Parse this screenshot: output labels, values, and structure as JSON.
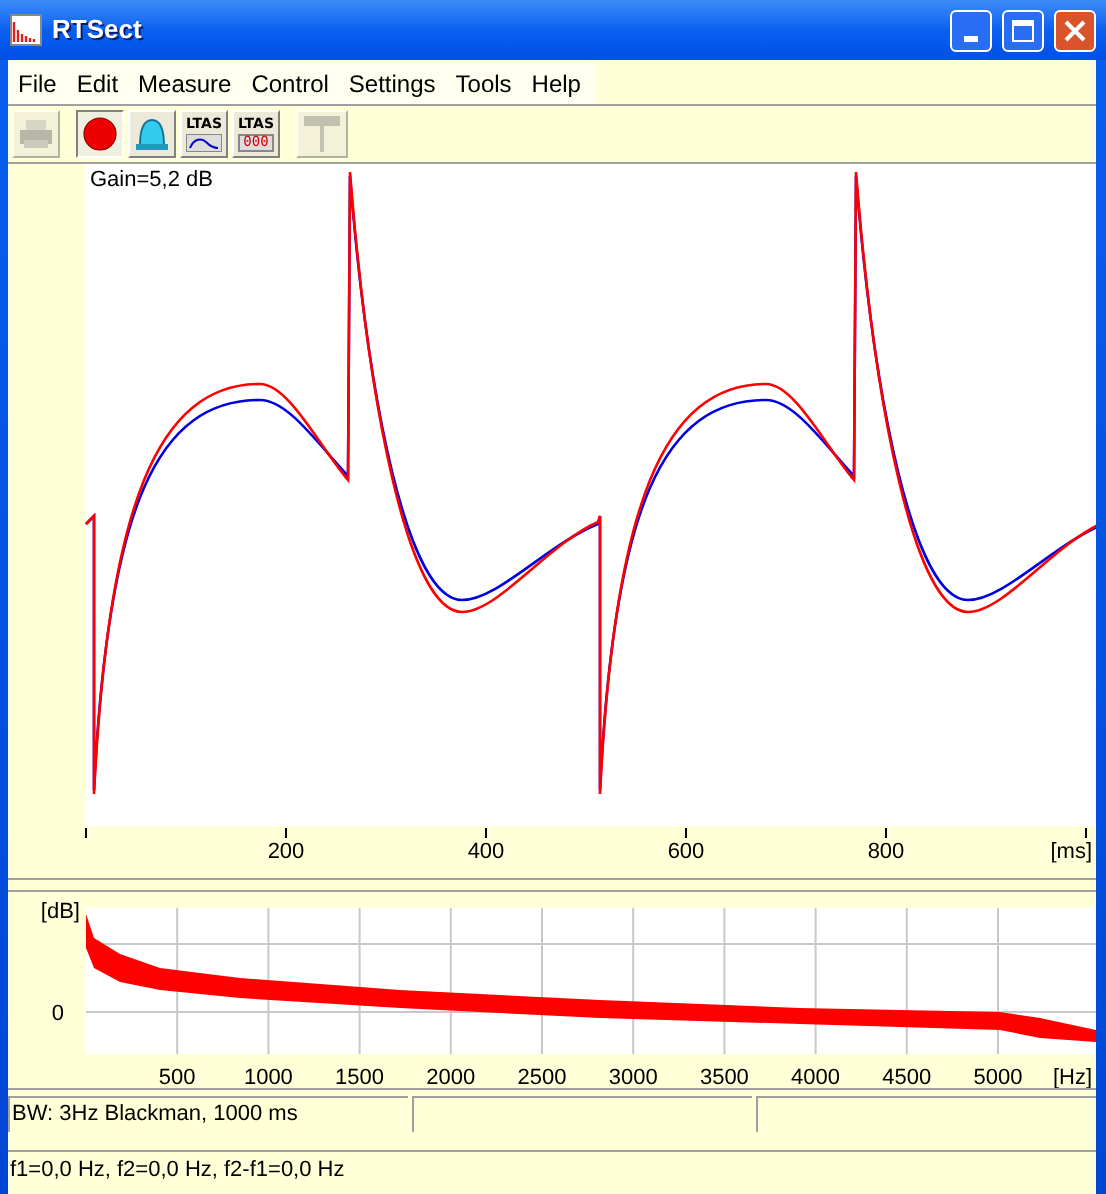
{
  "window": {
    "title": "RTSect"
  },
  "menu": [
    "File",
    "Edit",
    "Measure",
    "Control",
    "Settings",
    "Tools",
    "Help"
  ],
  "toolbar": [
    {
      "kind": "printer",
      "disabled": true,
      "pressed": false
    },
    {
      "kind": "record",
      "disabled": false,
      "pressed": true
    },
    {
      "kind": "bell",
      "disabled": false,
      "pressed": false
    },
    {
      "kind": "ltas-curve",
      "label": "LTAS",
      "disabled": false,
      "pressed": false
    },
    {
      "kind": "ltas-digits",
      "label": "LTAS",
      "digits": "000",
      "disabled": false,
      "pressed": false
    },
    {
      "kind": "pin",
      "disabled": true,
      "pressed": false
    }
  ],
  "waveform": {
    "gain": "Gain=5,2 dB",
    "x_ticks": [
      "200",
      "400",
      "600",
      "800"
    ],
    "x_unit": "[ms]"
  },
  "spectrum": {
    "y_unit": "[dB]",
    "y_ticks": [
      "0"
    ],
    "x_ticks": [
      "500",
      "1000",
      "1500",
      "2000",
      "2500",
      "3000",
      "3500",
      "4000",
      "4500",
      "5000"
    ],
    "x_unit": "[Hz]"
  },
  "status_bar": {
    "panes": [
      "BW: 3Hz Blackman, 1000 ms"
    ],
    "readout": "f1=0,0 Hz, f2=0,0 Hz, f2-f1=0,0 Hz"
  }
}
